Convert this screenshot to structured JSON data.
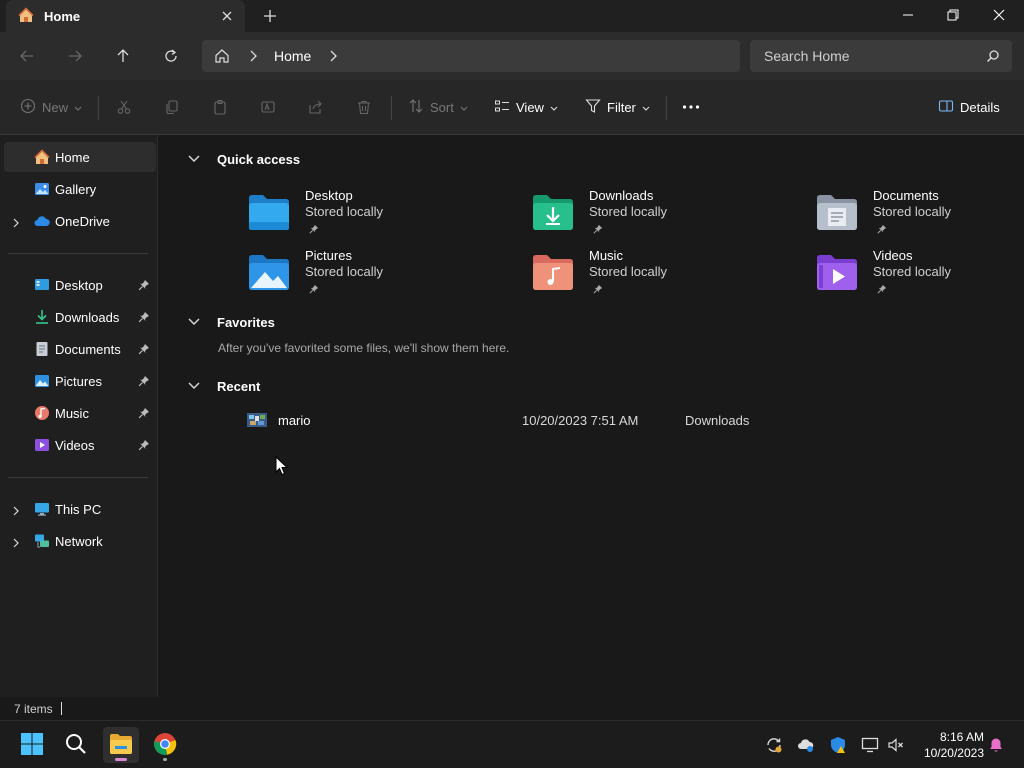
{
  "window": {
    "tab_title": "Home",
    "tab_icon": "home-icon",
    "controls": [
      "minimize-icon",
      "restore-icon",
      "close-icon"
    ]
  },
  "address": {
    "breadcrumb": [
      "Home"
    ],
    "search_placeholder": "Search Home"
  },
  "toolbar": {
    "new_label": "New",
    "sort_label": "Sort",
    "view_label": "View",
    "filter_label": "Filter",
    "details_label": "Details"
  },
  "sidebar": {
    "top": [
      {
        "label": "Home",
        "icon": "home-icon",
        "selected": true
      },
      {
        "label": "Gallery",
        "icon": "gallery-icon"
      },
      {
        "label": "OneDrive",
        "icon": "cloud-icon"
      }
    ],
    "pinned": [
      {
        "label": "Desktop",
        "icon": "desktop-icon"
      },
      {
        "label": "Downloads",
        "icon": "download-icon"
      },
      {
        "label": "Documents",
        "icon": "document-icon"
      },
      {
        "label": "Pictures",
        "icon": "pictures-icon"
      },
      {
        "label": "Music",
        "icon": "music-icon"
      },
      {
        "label": "Videos",
        "icon": "video-icon"
      }
    ],
    "bottom": [
      {
        "label": "This PC",
        "icon": "pc-icon"
      },
      {
        "label": "Network",
        "icon": "network-icon"
      }
    ]
  },
  "main": {
    "quick_access": {
      "title": "Quick access",
      "items": [
        {
          "name": "Desktop",
          "sub": "Stored locally"
        },
        {
          "name": "Downloads",
          "sub": "Stored locally"
        },
        {
          "name": "Documents",
          "sub": "Stored locally"
        },
        {
          "name": "Pictures",
          "sub": "Stored locally"
        },
        {
          "name": "Music",
          "sub": "Stored locally"
        },
        {
          "name": "Videos",
          "sub": "Stored locally"
        }
      ]
    },
    "favorites": {
      "title": "Favorites",
      "empty_text": "After you've favorited some files, we'll show them here."
    },
    "recent": {
      "title": "Recent",
      "items": [
        {
          "name": "mario",
          "date": "10/20/2023 7:51 AM",
          "location": "Downloads"
        }
      ]
    }
  },
  "status": {
    "items_count": "7 items"
  },
  "taskbar": {
    "time": "8:16 AM",
    "date": "10/20/2023"
  }
}
